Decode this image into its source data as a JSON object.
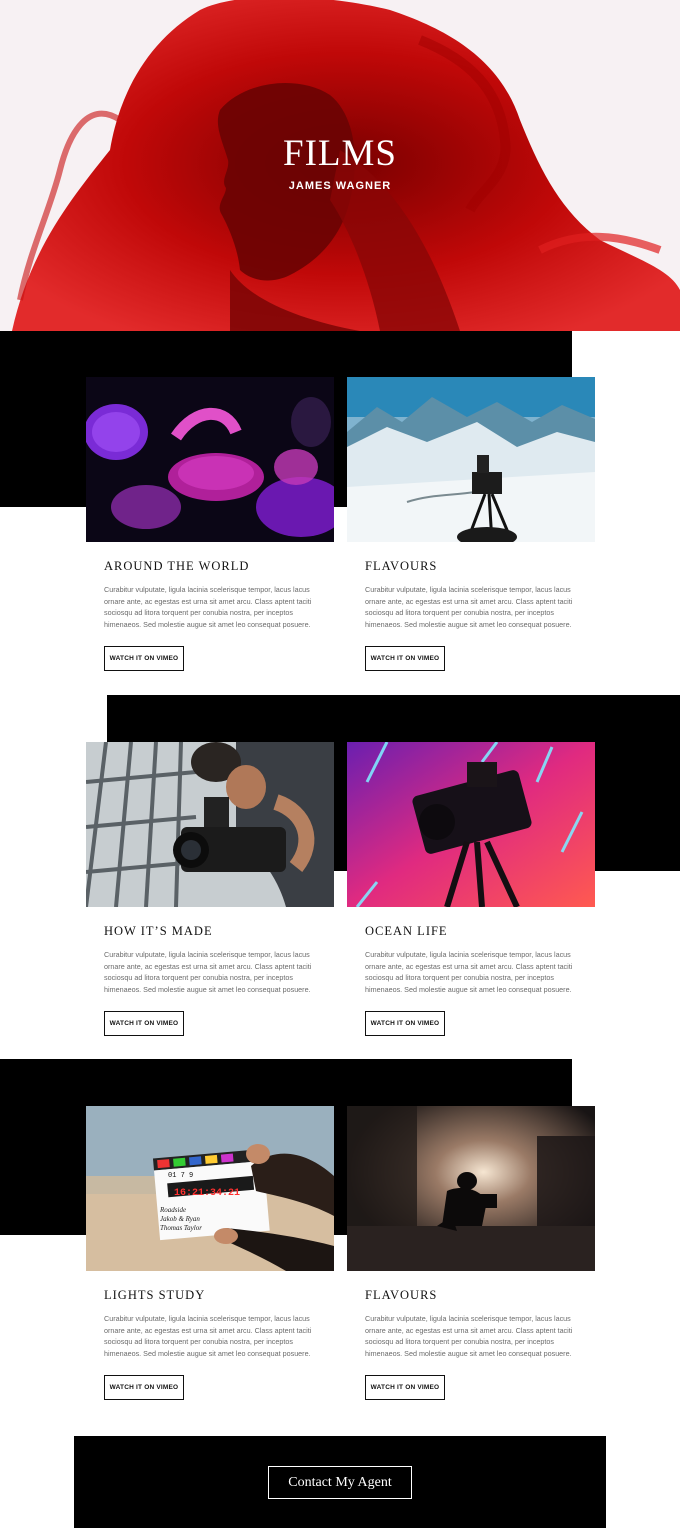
{
  "hero": {
    "title": "FILMS",
    "subtitle": "JAMES WAGNER"
  },
  "cards": [
    {
      "title": "AROUND THE WORLD",
      "image": "jellyfish",
      "body": "Curabitur vulputate, ligula lacinia scelerisque tempor, lacus lacus ornare ante, ac egestas est urna sit amet arcu. Class aptent taciti sociosqu ad litora torquent per conubia nostra, per inceptos himenaeos. Sed molestie augue sit amet leo consequat posuere.",
      "button": "WATCH IT ON VIMEO"
    },
    {
      "title": "FLAVOURS",
      "image": "mountain-camera",
      "body": "Curabitur vulputate, ligula lacinia scelerisque tempor, lacus lacus ornare ante, ac egestas est urna sit amet arcu. Class aptent taciti sociosqu ad litora torquent per conubia nostra, per inceptos himenaeos. Sed molestie augue sit amet leo consequat posuere.",
      "button": "WATCH IT ON VIMEO"
    },
    {
      "title": "HOW IT’S MADE",
      "image": "cameraman",
      "body": "Curabitur vulputate, ligula lacinia scelerisque tempor, lacus lacus ornare ante, ac egestas est urna sit amet arcu. Class aptent taciti sociosqu ad litora torquent per conubia nostra, per inceptos himenaeos. Sed molestie augue sit amet leo consequat posuere.",
      "button": "WATCH IT ON VIMEO"
    },
    {
      "title": "OCEAN LIFE",
      "image": "neon-camera",
      "body": "Curabitur vulputate, ligula lacinia scelerisque tempor, lacus lacus ornare ante, ac egestas est urna sit amet arcu. Class aptent taciti sociosqu ad litora torquent per conubia nostra, per inceptos himenaeos. Sed molestie augue sit amet leo consequat posuere.",
      "button": "WATCH IT ON VIMEO"
    },
    {
      "title": "LIGHTS STUDY",
      "image": "clapperboard",
      "body": "Curabitur vulputate, ligula lacinia scelerisque tempor, lacus lacus ornare ante, ac egestas est urna sit amet arcu. Class aptent taciti sociosqu ad litora torquent per conubia nostra, per inceptos himenaeos. Sed molestie augue sit amet leo consequat posuere.",
      "button": "WATCH IT ON VIMEO"
    },
    {
      "title": "FLAVOURS",
      "image": "night-shoot",
      "body": "Curabitur vulputate, ligula lacinia scelerisque tempor, lacus lacus ornare ante, ac egestas est urna sit amet arcu. Class aptent taciti sociosqu ad litora torquent per conubia nostra, per inceptos himenaeos. Sed molestie augue sit amet leo consequat posuere.",
      "button": "WATCH IT ON VIMEO"
    }
  ],
  "clapperboard": {
    "numbers": "01  7  9",
    "timecode": "16:21:34:21",
    "line1": "Roadside",
    "line2": "Jakob & Ryan",
    "line3": "Thomas Taylor"
  },
  "contact": {
    "button": "Contact My Agent"
  },
  "colors": {
    "hero_ink": "#d40a0a",
    "background": "#ffffff",
    "block": "#000000"
  }
}
